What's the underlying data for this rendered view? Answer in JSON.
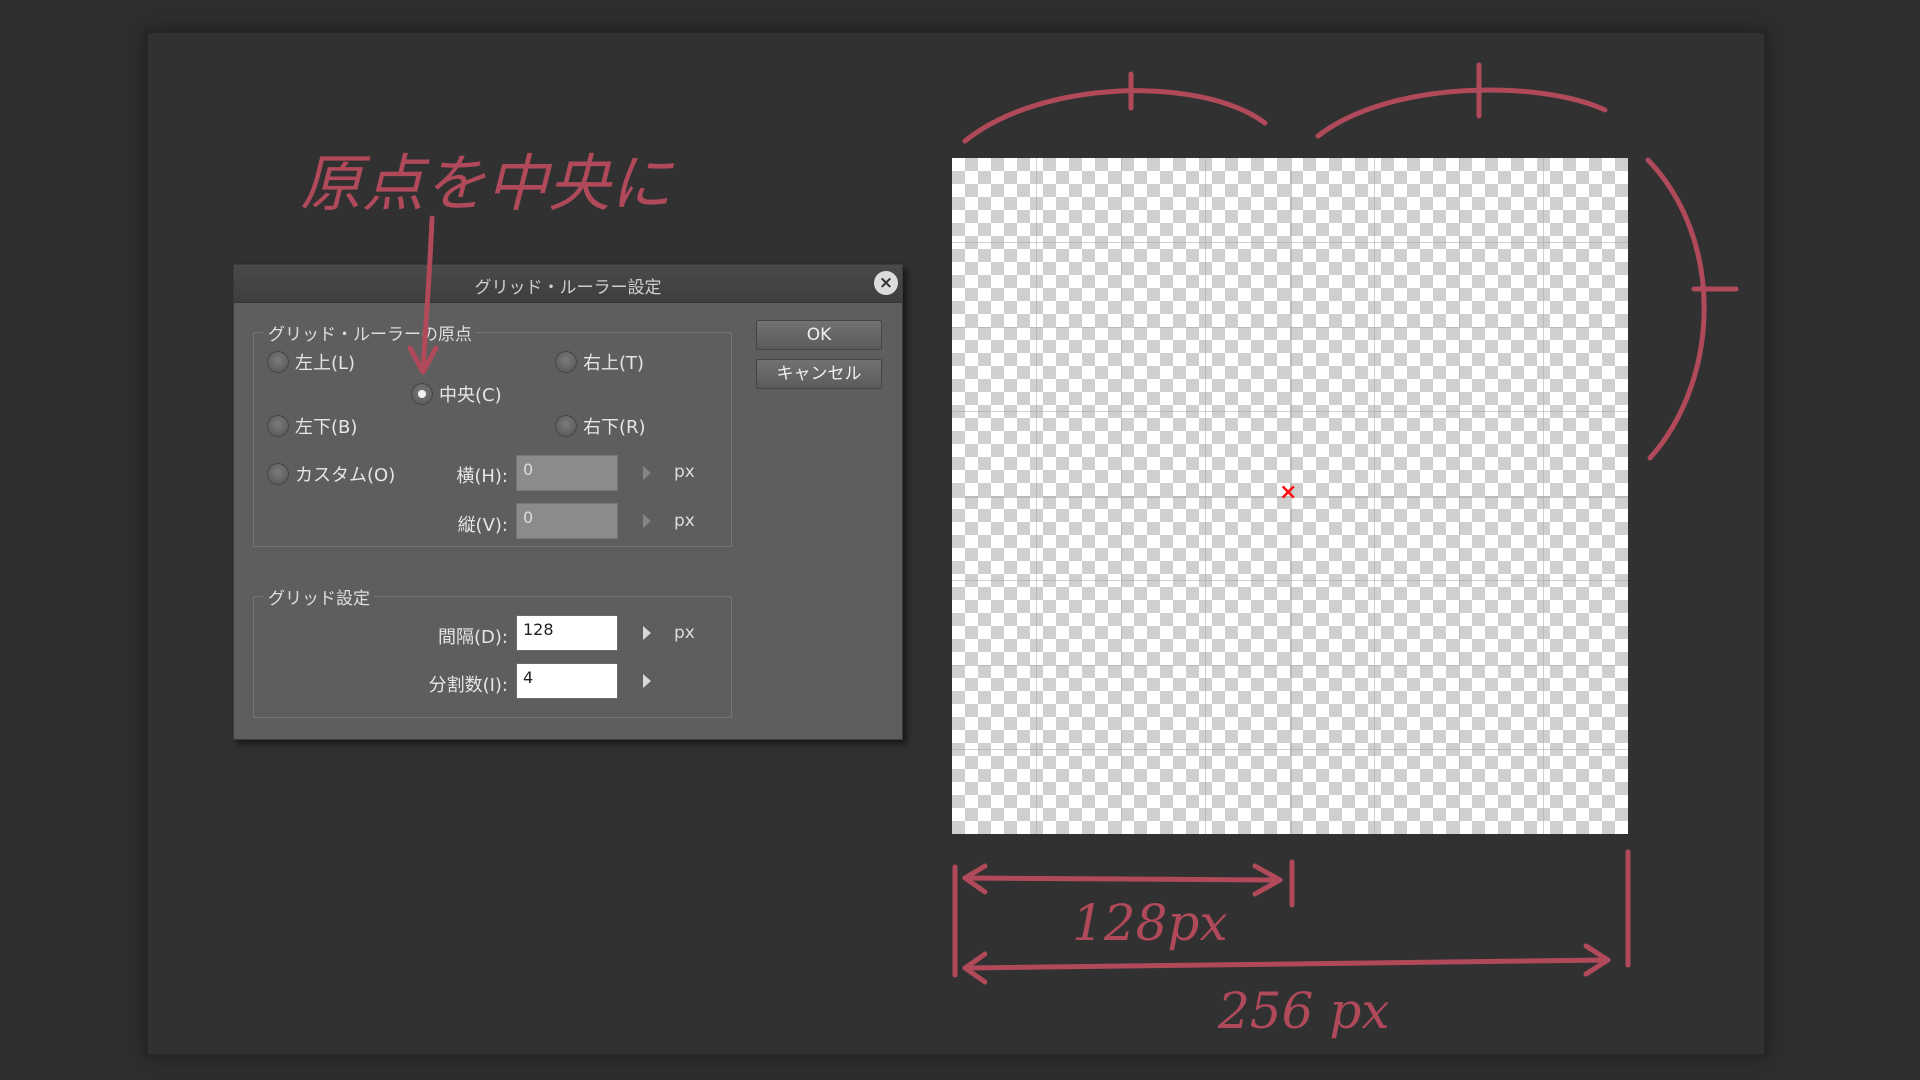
{
  "dialog": {
    "title": "グリッド・ルーラー設定",
    "close_icon": "×",
    "origin_group": {
      "legend": "グリッド・ルーラーの原点",
      "options": {
        "top_left": "左上(L)",
        "top_right": "右上(T)",
        "center": "中央(C)",
        "bottom_left": "左下(B)",
        "bottom_right": "右下(R)",
        "custom": "カスタム(O)"
      },
      "selected": "center",
      "horizontal": {
        "label": "横(H):",
        "value": "0",
        "unit": "px"
      },
      "vertical": {
        "label": "縦(V):",
        "value": "0",
        "unit": "px"
      }
    },
    "grid_group": {
      "legend": "グリッド設定",
      "interval": {
        "label": "間隔(D):",
        "value": "128",
        "unit": "px"
      },
      "divisions": {
        "label": "分割数(I):",
        "value": "4"
      }
    },
    "buttons": {
      "ok": "OK",
      "cancel": "キャンセル"
    }
  },
  "annotations": {
    "note": "原点を中央に",
    "short_measure": "128px",
    "long_measure": "256 px",
    "color": "#b04a5a"
  },
  "canvas": {
    "center_marker": "×",
    "marker_color": "#ff1010"
  }
}
